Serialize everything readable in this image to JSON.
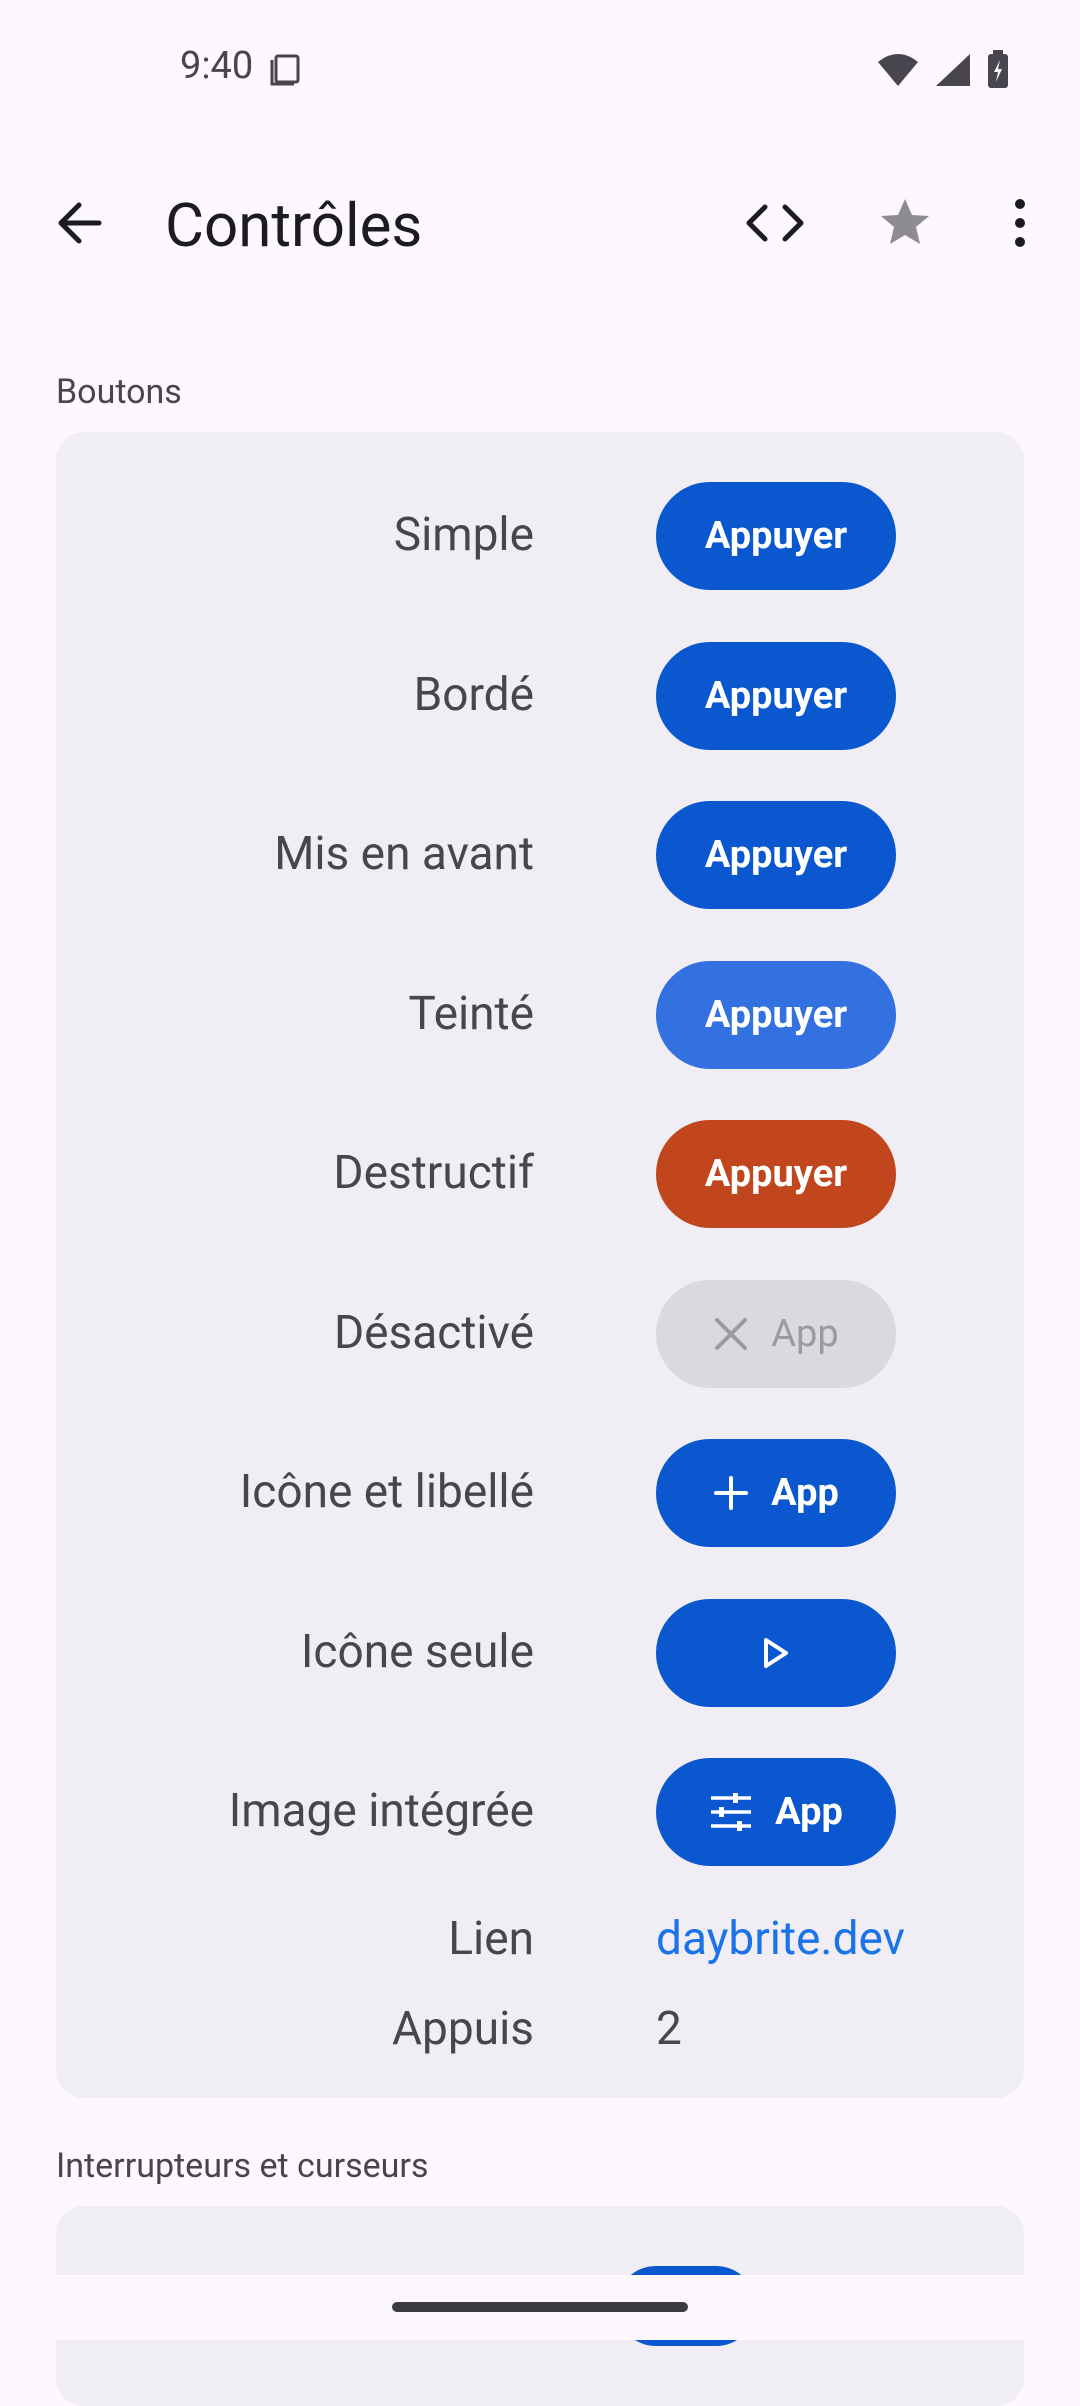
{
  "status": {
    "time": "9:40"
  },
  "app_bar": {
    "title": "Contrôles"
  },
  "sections": {
    "buttons": {
      "label": "Boutons"
    },
    "switches": {
      "label": "Interrupteurs et curseurs"
    }
  },
  "rows": [
    {
      "label": "Simple",
      "button": "Appuyer"
    },
    {
      "label": "Bordé",
      "button": "Appuyer"
    },
    {
      "label": "Mis en avant",
      "button": "Appuyer"
    },
    {
      "label": "Teinté",
      "button": "Appuyer"
    },
    {
      "label": "Destructif",
      "button": "Appuyer"
    },
    {
      "label": "Désactivé",
      "button": "App"
    },
    {
      "label": "Icône et libellé",
      "button": "App"
    },
    {
      "label": "Icône seule",
      "button": ""
    },
    {
      "label": "Image intégrée",
      "button": "App"
    }
  ],
  "link_row": {
    "label": "Lien",
    "value": "daybrite.dev"
  },
  "taps_row": {
    "label": "Appuis",
    "value": "2"
  },
  "colors": {
    "primary": "#0b57d0",
    "tinted": "#3370e0",
    "danger": "#c1461d",
    "disabled": "#dcd8df",
    "link": "#1a73e8"
  }
}
